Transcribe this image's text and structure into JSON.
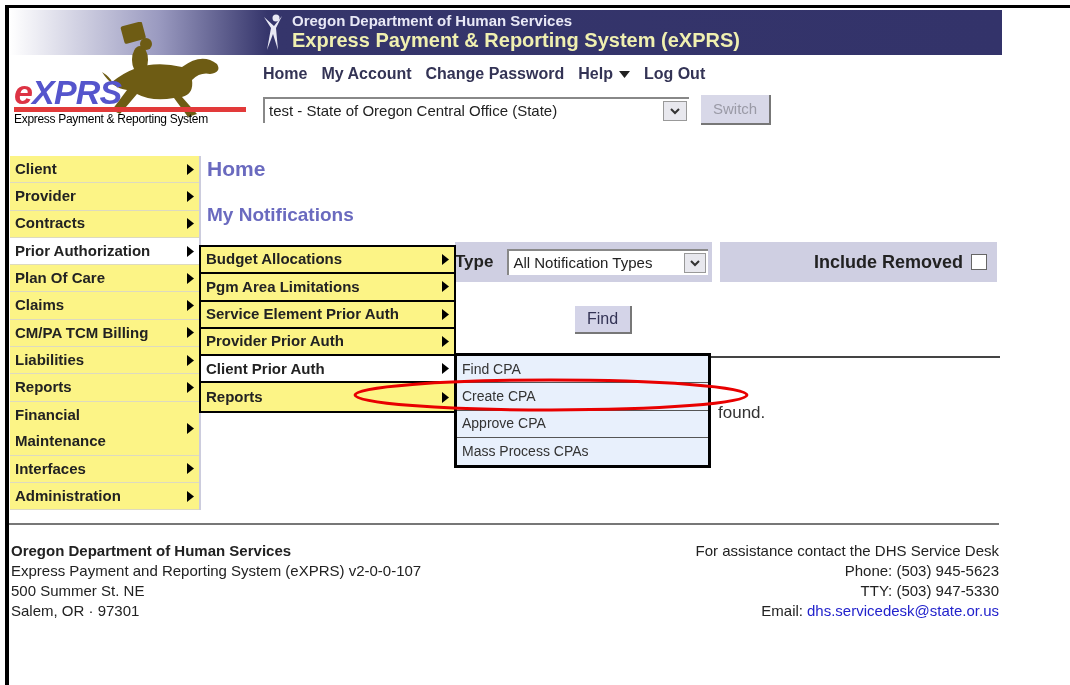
{
  "header": {
    "agency": "Oregon Department of Human Services",
    "system_title": "Express Payment & Reporting System (eXPRS)",
    "logo_text": "eXPRS",
    "logo_subtitle": "Express Payment & Reporting System"
  },
  "nav_links": [
    {
      "label": "Home",
      "kind": "link"
    },
    {
      "label": "My Account",
      "kind": "link"
    },
    {
      "label": "Change Password",
      "kind": "link"
    },
    {
      "label": "Help",
      "kind": "dropdown"
    },
    {
      "label": "Log Out",
      "kind": "link"
    }
  ],
  "organization_select": {
    "value": "test - State of Oregon Central Office (State)"
  },
  "switch_button": {
    "label": "Switch",
    "disabled": true
  },
  "side_menu": [
    {
      "label": "Client",
      "selected": false
    },
    {
      "label": "Provider",
      "selected": false
    },
    {
      "label": "Contracts",
      "selected": false
    },
    {
      "label": "Prior Authorization",
      "selected": true
    },
    {
      "label": "Plan Of Care",
      "selected": false
    },
    {
      "label": "Claims",
      "selected": false
    },
    {
      "label": "CM/PA TCM Billing",
      "selected": false
    },
    {
      "label": "Liabilities",
      "selected": false
    },
    {
      "label": "Reports",
      "selected": false
    },
    {
      "label": "Financial Maintenance",
      "selected": false
    },
    {
      "label": "Interfaces",
      "selected": false
    },
    {
      "label": "Administration",
      "selected": false
    }
  ],
  "content": {
    "title": "Home",
    "subtitle": "My Notifications",
    "type_label": "Type",
    "type_select": "All Notification Types",
    "include_removed": {
      "label": "Include Removed",
      "checked": false
    },
    "find_button": "Find",
    "result_text": "found."
  },
  "submenu": [
    {
      "label": "Budget Allocations",
      "selected": false
    },
    {
      "label": "Pgm Area Limitations",
      "selected": false
    },
    {
      "label": "Service Element Prior Auth",
      "selected": false
    },
    {
      "label": "Provider Prior Auth",
      "selected": false
    },
    {
      "label": "Client Prior Auth",
      "selected": true
    },
    {
      "label": "Reports",
      "selected": false
    }
  ],
  "submenu_2": [
    {
      "label": "Find CPA",
      "selected": false
    },
    {
      "label": "Create CPA",
      "selected": false
    },
    {
      "label": "Approve CPA",
      "selected": false
    },
    {
      "label": "Mass Process CPAs",
      "selected": false
    }
  ],
  "footer": {
    "organization": "Oregon Department of Human Services",
    "address_lines": [
      "Express Payment and Reporting System (eXPRS) v2-0-0-107",
      "500 Summer St. NE",
      "Salem, OR · 97301"
    ],
    "assistance": "For assistance contact the DHS Service Desk",
    "contact_lines": [
      "Phone: (503) 945-5623",
      "TTY: (503) 947-5330"
    ],
    "email_label": "Email:",
    "email": "dhs.servicedesk@state.or.us"
  }
}
